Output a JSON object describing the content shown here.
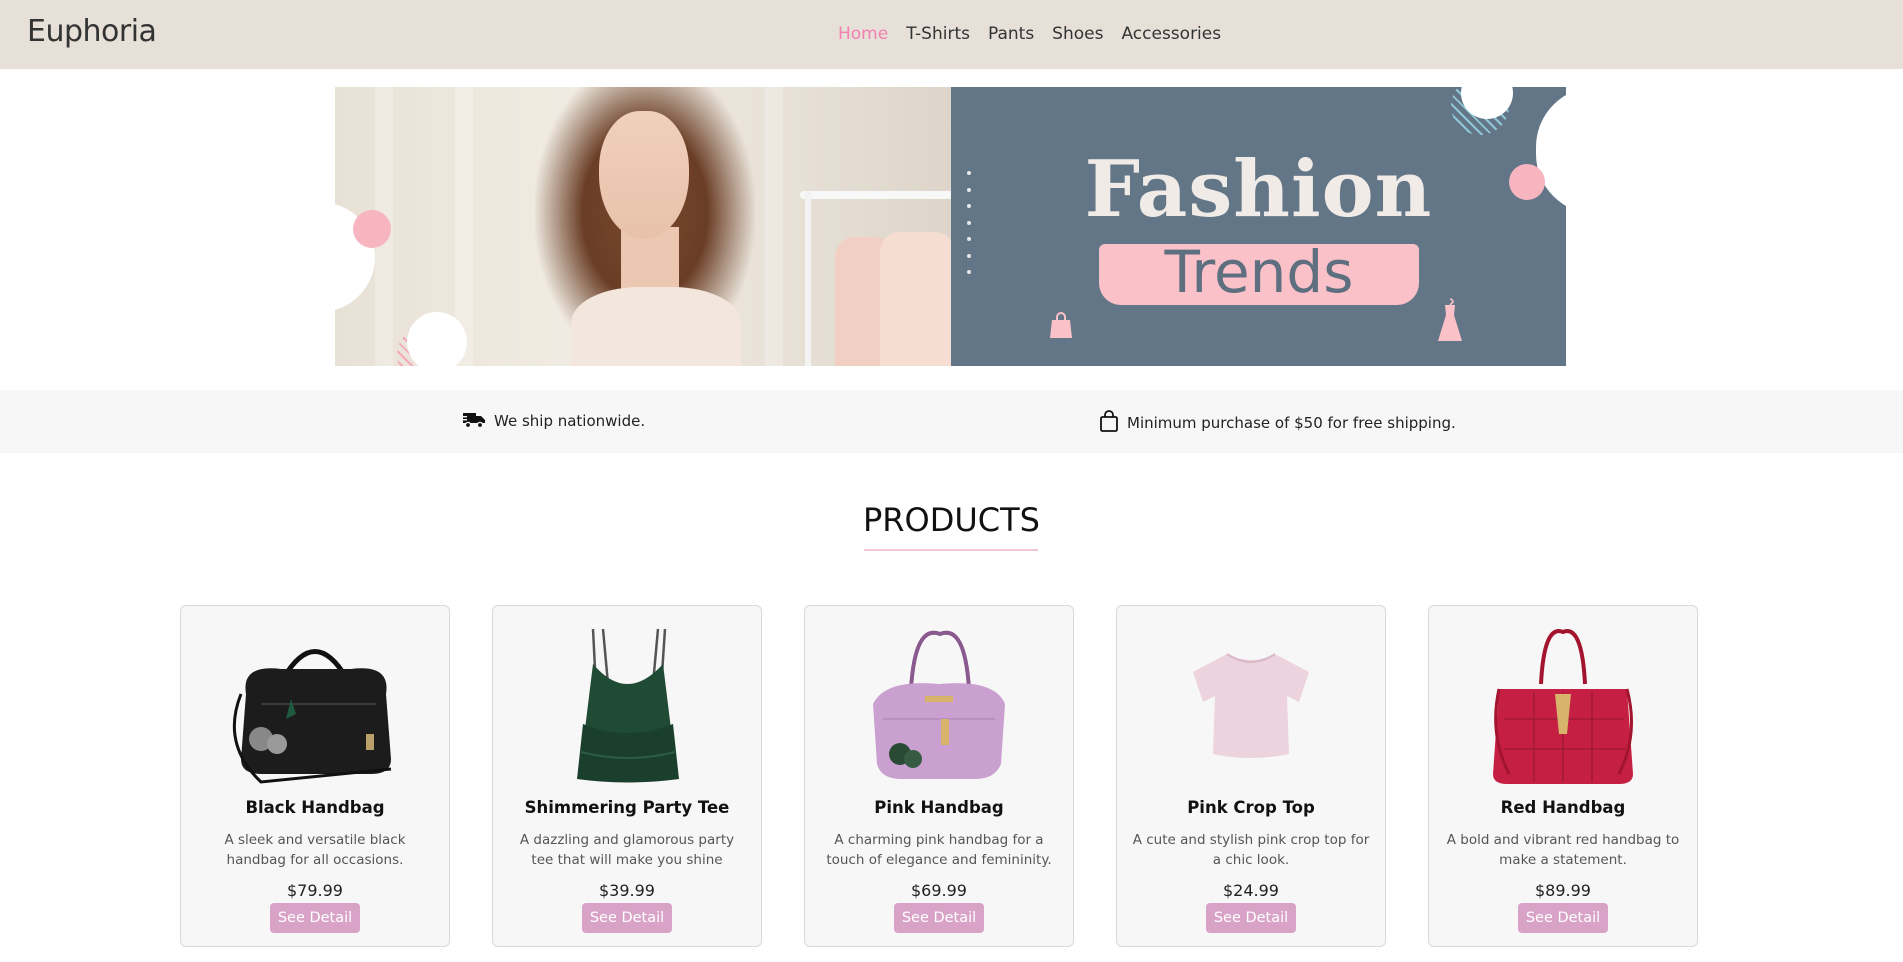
{
  "brand": {
    "name": "Euphoria"
  },
  "nav": {
    "items": [
      {
        "label": "Home",
        "active": true
      },
      {
        "label": "T-Shirts",
        "active": false
      },
      {
        "label": "Pants",
        "active": false
      },
      {
        "label": "Shoes",
        "active": false
      },
      {
        "label": "Accessories",
        "active": false
      }
    ]
  },
  "banner": {
    "title": "Fashion",
    "subtitle": "Trends"
  },
  "info": {
    "shipping_text": "We ship nationwide.",
    "shipping_icon": "truck-icon",
    "minimum_text": "Minimum purchase of $50 for free shipping.",
    "minimum_icon": "shopping-bag-icon"
  },
  "products": {
    "heading": "PRODUCTS",
    "items": [
      {
        "name": "Black Handbag",
        "description": "A sleek and versatile black handbag for all occasions.",
        "price": "$79.99",
        "button": "See Detail",
        "image_color": "#1c1c1c"
      },
      {
        "name": "Shimmering Party Tee",
        "description": "A dazzling and glamorous party tee that will make you shine",
        "price": "$39.99",
        "button": "See Detail",
        "image_color": "#1f4a33"
      },
      {
        "name": "Pink Handbag",
        "description": "A charming pink handbag for a touch of elegance and femininity.",
        "price": "$69.99",
        "button": "See Detail",
        "image_color": "#c9a0cf"
      },
      {
        "name": "Pink Crop Top",
        "description": "A cute and stylish pink crop top for a chic look.",
        "price": "$24.99",
        "button": "See Detail",
        "image_color": "#ecd3de"
      },
      {
        "name": "Red Handbag",
        "description": "A bold and vibrant red handbag to make a statement.",
        "price": "$89.99",
        "button": "See Detail",
        "image_color": "#c51f44"
      }
    ]
  },
  "colors": {
    "header_bg": "#e6e0d9",
    "accent_pink": "#f280b1",
    "button_bg": "#d9a3c8",
    "banner_blue": "#637687"
  }
}
